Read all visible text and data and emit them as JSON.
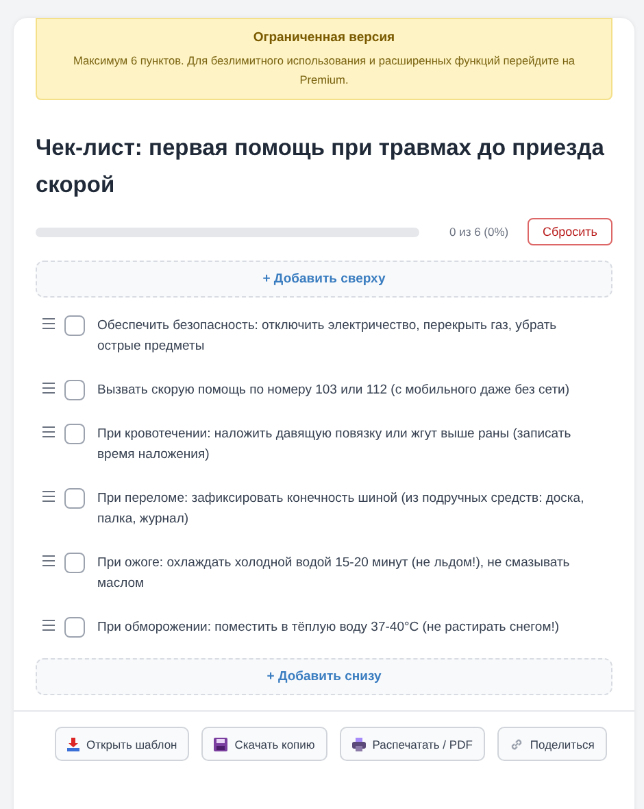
{
  "banner": {
    "title": "Ограниченная версия",
    "text": "Максимум 6 пунктов. Для безлимитного использования и расширенных функций перейдите на Premium."
  },
  "title": "Чек-лист: первая помощь при травмах до приезда скорой",
  "progress": {
    "level": 0,
    "reading": "0 из 6 (0%)",
    "reset": "Сбросить"
  },
  "add_top": "+ Добавить сверху",
  "items": [
    {
      "text": "Обеспечить безопасность: отключить электричество, перекрыть газ, убрать острые предметы",
      "checked": false
    },
    {
      "text": "Вызвать скорую помощь по номеру 103 или 112 (с мобильного даже без сети)",
      "checked": false
    },
    {
      "text": "При кровотечении: наложить давящую повязку или жгут выше раны (записать время наложения)",
      "checked": false
    },
    {
      "text": "При переломе: зафиксировать конечность шиной (из подручных средств: доска, палка, журнал)",
      "checked": false
    },
    {
      "text": "При ожоге: охлаждать холодной водой 15-20 минут (не льдом!), не смазывать маслом",
      "checked": false
    },
    {
      "text": "При обморожении: поместить в тёплую воду 37-40°C (не растирать снегом!)",
      "checked": false
    }
  ],
  "add_bottom": "+ Добавить снизу",
  "footer": [
    {
      "kind": "open",
      "label": "Открыть шаблон"
    },
    {
      "kind": "download",
      "label": "Скачать копию"
    },
    {
      "kind": "print",
      "label": "Распечатать / PDF"
    },
    {
      "kind": "share",
      "label": "Поделиться"
    }
  ]
}
